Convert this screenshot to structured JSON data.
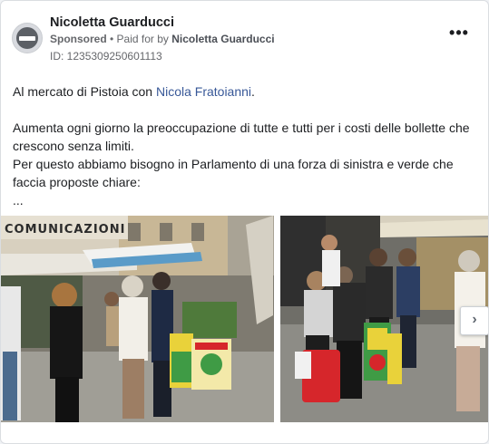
{
  "ad": {
    "page_name": "Nicoletta Guarducci",
    "sponsored_label": "Sponsored",
    "separator": " • ",
    "paid_for_label": "Paid for by ",
    "payer_name": "Nicoletta Guarducci",
    "ad_id": "ID: 1235309250601113",
    "more_label": "•••"
  },
  "post": {
    "line1_prefix": "Al mercato di Pistoia con ",
    "line1_mention": "Nicola Fratoianni",
    "line1_suffix": ".",
    "para2_line1": "Aumenta ogni giorno la preoccupazione di tutte e tutti per i costi delle bollette che",
    "para2_line2": "crescono senza limiti.",
    "para3_line1": "Per questo abbiamo bisogno in Parlamento di una forza di sinistra e verde che",
    "para3_line2": "faccia proposte chiare:",
    "ellipsis": "..."
  },
  "gallery": {
    "shop_sign": "COMUNICAZIONI",
    "next_label": "›"
  },
  "colors": {
    "mention": "#385898",
    "bag_red": "#d6262b",
    "poster_green": "#3f9b45",
    "poster_yellow": "#e9d23a"
  }
}
